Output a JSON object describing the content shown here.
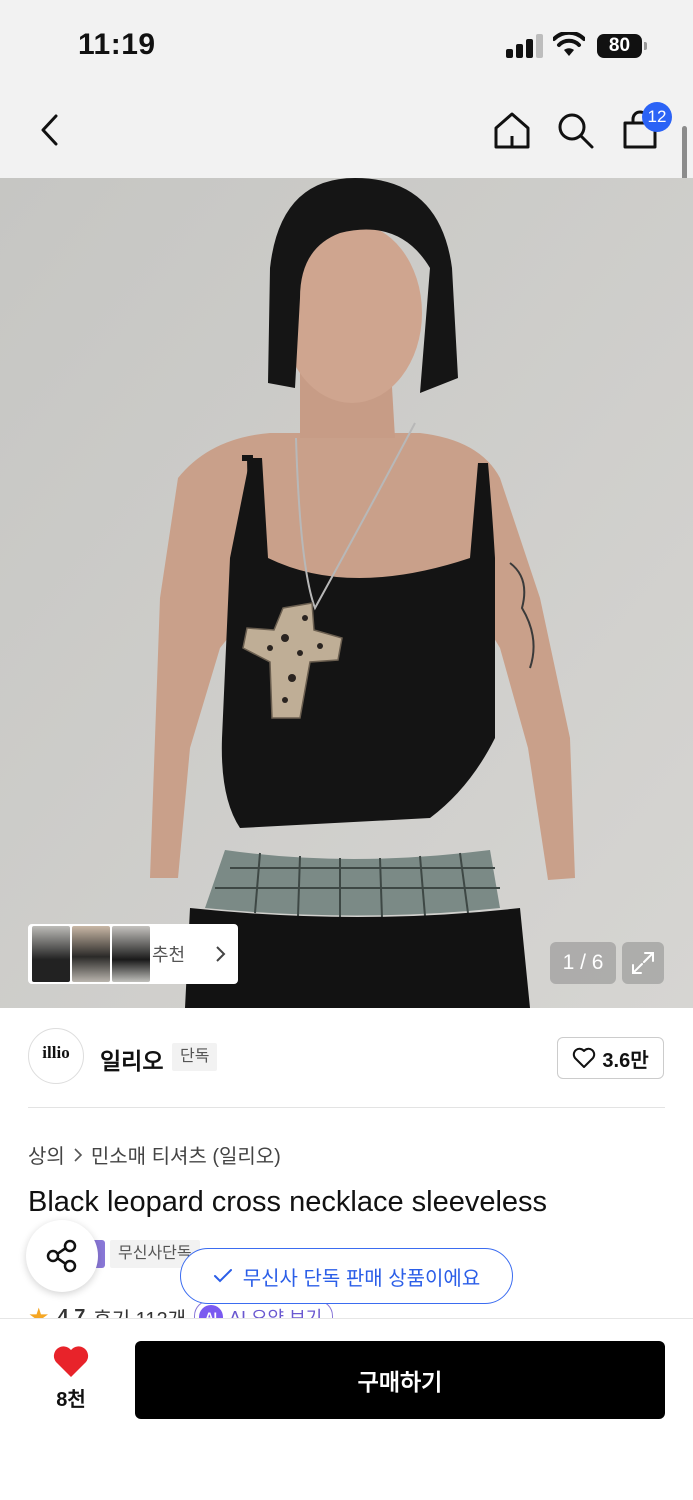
{
  "status_bar": {
    "time": "11:19",
    "battery": "80"
  },
  "nav": {
    "cart_count": "12",
    "icons": [
      "back-chevron-icon",
      "home-icon",
      "search-icon",
      "cart-bag-icon"
    ]
  },
  "gallery": {
    "recommend_label": "추천",
    "page_indicator": "1 / 6"
  },
  "brand": {
    "logo_text": "illio",
    "name": "일리오",
    "exclusive_tag": "단독",
    "like_count": "3.6만"
  },
  "product": {
    "breadcrumb": [
      "상의",
      "민소매 티셔츠 (일리오)"
    ],
    "title": "Black leopard cross necklace sleeveless",
    "musinsa_tag": "무신사단독",
    "toast": "무신사 단독 판매 상품이에요",
    "rating": "4.7",
    "reviews": "후기 112개",
    "ai_label": "AI",
    "ai_summary": "AI 요약 보기"
  },
  "bottom_bar": {
    "wish_count": "8천",
    "buy_label": "구매하기"
  },
  "colors": {
    "accent_blue": "#2b63f6",
    "heart_red": "#e8232a",
    "ai_purple": "#7a5af0",
    "buy_black": "#000000"
  }
}
